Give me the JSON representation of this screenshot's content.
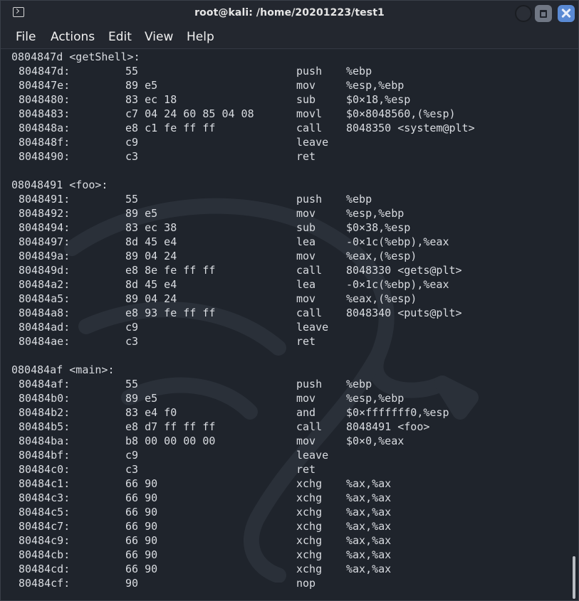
{
  "window": {
    "title": "root@kali: /home/20201223/test1",
    "controls": [
      "minimize-button",
      "maximize-button",
      "close-button"
    ]
  },
  "menu": [
    "File",
    "Actions",
    "Edit",
    "View",
    "Help"
  ],
  "colors": {
    "background": "#1f242c",
    "text": "#d9dce1",
    "titlebar": "#23272f",
    "close_button": "#5a8ad4"
  },
  "lines": [
    {
      "header": "0804847d <getShell>:"
    },
    {
      "addr": "804847d:",
      "bytes": "55",
      "mnemonic": "push",
      "operands": "%ebp"
    },
    {
      "addr": "804847e:",
      "bytes": "89 e5",
      "mnemonic": "mov",
      "operands": "%esp,%ebp"
    },
    {
      "addr": "8048480:",
      "bytes": "83 ec 18",
      "mnemonic": "sub",
      "operands": "$0×18,%esp"
    },
    {
      "addr": "8048483:",
      "bytes": "c7 04 24 60 85 04 08",
      "mnemonic": "movl",
      "operands": "$0×8048560,(%esp)"
    },
    {
      "addr": "804848a:",
      "bytes": "e8 c1 fe ff ff",
      "mnemonic": "call",
      "operands": "8048350 <system@plt>"
    },
    {
      "addr": "804848f:",
      "bytes": "c9",
      "mnemonic": "leave",
      "operands": ""
    },
    {
      "addr": "8048490:",
      "bytes": "c3",
      "mnemonic": "ret",
      "operands": ""
    },
    {
      "blank": true
    },
    {
      "header": "08048491 <foo>:"
    },
    {
      "addr": "8048491:",
      "bytes": "55",
      "mnemonic": "push",
      "operands": "%ebp"
    },
    {
      "addr": "8048492:",
      "bytes": "89 e5",
      "mnemonic": "mov",
      "operands": "%esp,%ebp"
    },
    {
      "addr": "8048494:",
      "bytes": "83 ec 38",
      "mnemonic": "sub",
      "operands": "$0×38,%esp"
    },
    {
      "addr": "8048497:",
      "bytes": "8d 45 e4",
      "mnemonic": "lea",
      "operands": "-0×1c(%ebp),%eax"
    },
    {
      "addr": "804849a:",
      "bytes": "89 04 24",
      "mnemonic": "mov",
      "operands": "%eax,(%esp)"
    },
    {
      "addr": "804849d:",
      "bytes": "e8 8e fe ff ff",
      "mnemonic": "call",
      "operands": "8048330 <gets@plt>"
    },
    {
      "addr": "80484a2:",
      "bytes": "8d 45 e4",
      "mnemonic": "lea",
      "operands": "-0×1c(%ebp),%eax"
    },
    {
      "addr": "80484a5:",
      "bytes": "89 04 24",
      "mnemonic": "mov",
      "operands": "%eax,(%esp)"
    },
    {
      "addr": "80484a8:",
      "bytes": "e8 93 fe ff ff",
      "mnemonic": "call",
      "operands": "8048340 <puts@plt>"
    },
    {
      "addr": "80484ad:",
      "bytes": "c9",
      "mnemonic": "leave",
      "operands": ""
    },
    {
      "addr": "80484ae:",
      "bytes": "c3",
      "mnemonic": "ret",
      "operands": ""
    },
    {
      "blank": true
    },
    {
      "header": "080484af <main>:"
    },
    {
      "addr": "80484af:",
      "bytes": "55",
      "mnemonic": "push",
      "operands": "%ebp"
    },
    {
      "addr": "80484b0:",
      "bytes": "89 e5",
      "mnemonic": "mov",
      "operands": "%esp,%ebp"
    },
    {
      "addr": "80484b2:",
      "bytes": "83 e4 f0",
      "mnemonic": "and",
      "operands": "$0×fffffff0,%esp"
    },
    {
      "addr": "80484b5:",
      "bytes": "e8 d7 ff ff ff",
      "mnemonic": "call",
      "operands": "8048491 <foo>"
    },
    {
      "addr": "80484ba:",
      "bytes": "b8 00 00 00 00",
      "mnemonic": "mov",
      "operands": "$0×0,%eax"
    },
    {
      "addr": "80484bf:",
      "bytes": "c9",
      "mnemonic": "leave",
      "operands": ""
    },
    {
      "addr": "80484c0:",
      "bytes": "c3",
      "mnemonic": "ret",
      "operands": ""
    },
    {
      "addr": "80484c1:",
      "bytes": "66 90",
      "mnemonic": "xchg",
      "operands": "%ax,%ax"
    },
    {
      "addr": "80484c3:",
      "bytes": "66 90",
      "mnemonic": "xchg",
      "operands": "%ax,%ax"
    },
    {
      "addr": "80484c5:",
      "bytes": "66 90",
      "mnemonic": "xchg",
      "operands": "%ax,%ax"
    },
    {
      "addr": "80484c7:",
      "bytes": "66 90",
      "mnemonic": "xchg",
      "operands": "%ax,%ax"
    },
    {
      "addr": "80484c9:",
      "bytes": "66 90",
      "mnemonic": "xchg",
      "operands": "%ax,%ax"
    },
    {
      "addr": "80484cb:",
      "bytes": "66 90",
      "mnemonic": "xchg",
      "operands": "%ax,%ax"
    },
    {
      "addr": "80484cd:",
      "bytes": "66 90",
      "mnemonic": "xchg",
      "operands": "%ax,%ax"
    },
    {
      "addr": "80484cf:",
      "bytes": "90",
      "mnemonic": "nop",
      "operands": ""
    }
  ]
}
